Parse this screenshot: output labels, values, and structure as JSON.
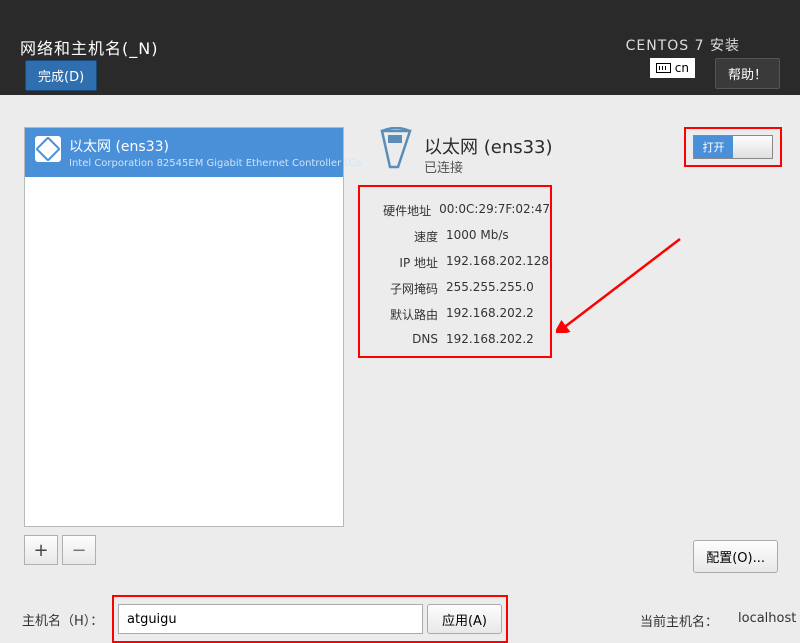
{
  "header": {
    "title": "网络和主机名(_N)",
    "done_label": "完成(D)",
    "install_title": "CENTOS 7 安装",
    "keyboard": "cn",
    "help_label": "帮助！"
  },
  "device_list": {
    "items": [
      {
        "name": "以太网 (ens33)",
        "sub": "Intel Corporation 82545EM Gigabit Ethernet Controller (Co"
      }
    ]
  },
  "buttons": {
    "add": "+",
    "remove": "−",
    "configure": "配置(O)...",
    "apply": "应用(A)"
  },
  "detail": {
    "title": "以太网 (ens33)",
    "status": "已连接",
    "toggle_on_label": "打开",
    "rows": {
      "hwaddr_label": "硬件地址",
      "hwaddr": "00:0C:29:7F:02:47",
      "speed_label": "速度",
      "speed": "1000 Mb/s",
      "ip_label": "IP 地址",
      "ip": "192.168.202.128",
      "mask_label": "子网掩码",
      "mask": "255.255.255.0",
      "route_label": "默认路由",
      "route": "192.168.202.2",
      "dns_label": "DNS",
      "dns": "192.168.202.2"
    }
  },
  "hostname": {
    "label": "主机名（H）：",
    "value": "atguigu",
    "current_label": "当前主机名：",
    "current_value": "localhost"
  }
}
